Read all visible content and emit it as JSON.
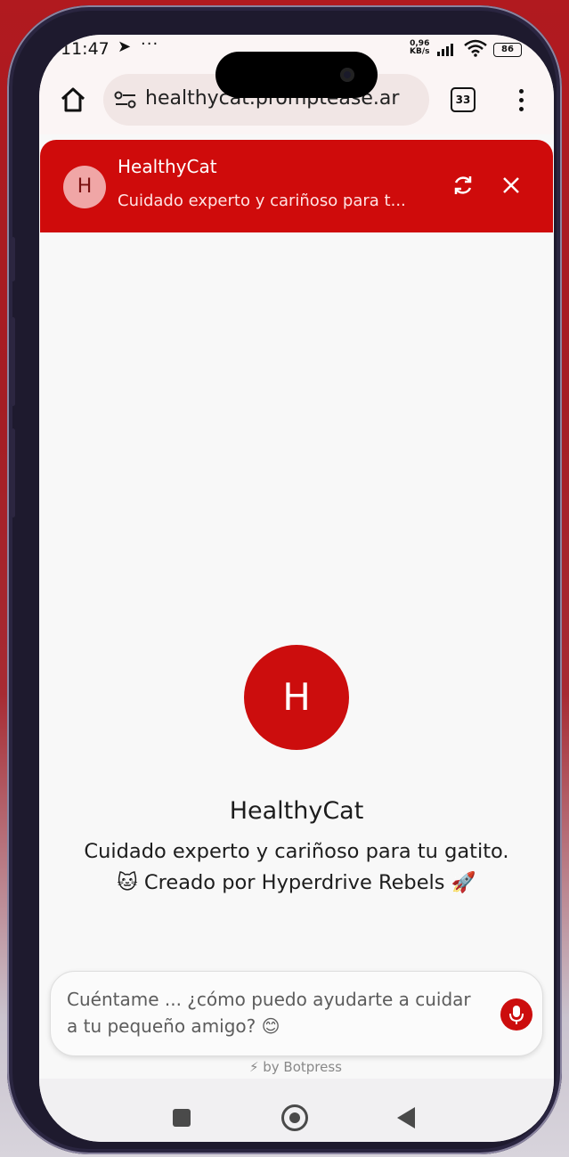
{
  "status_bar": {
    "time": "11:47",
    "net_speed_value": "0,96",
    "net_speed_unit": "KB/s",
    "battery": "86"
  },
  "browser": {
    "url": "healthycat.promptease.ar",
    "tab_count": "33"
  },
  "chat_header": {
    "avatar_letter": "H",
    "title": "HealthyCat",
    "subtitle": "Cuidado experto y cariñoso para t..."
  },
  "welcome": {
    "avatar_letter": "H",
    "bot_name": "HealthyCat",
    "description_line1": "Cuidado experto y cariñoso para tu gatito.",
    "description_line2": "🐱 Creado por Hyperdrive Rebels 🚀"
  },
  "composer": {
    "placeholder": "Cuéntame ... ¿cómo puedo ayudarte a cuidar a tu pequeño amigo? 😊"
  },
  "footer": {
    "powered_by": "⚡ by Botpress"
  },
  "colors": {
    "brand_red": "#cc0d0d"
  }
}
